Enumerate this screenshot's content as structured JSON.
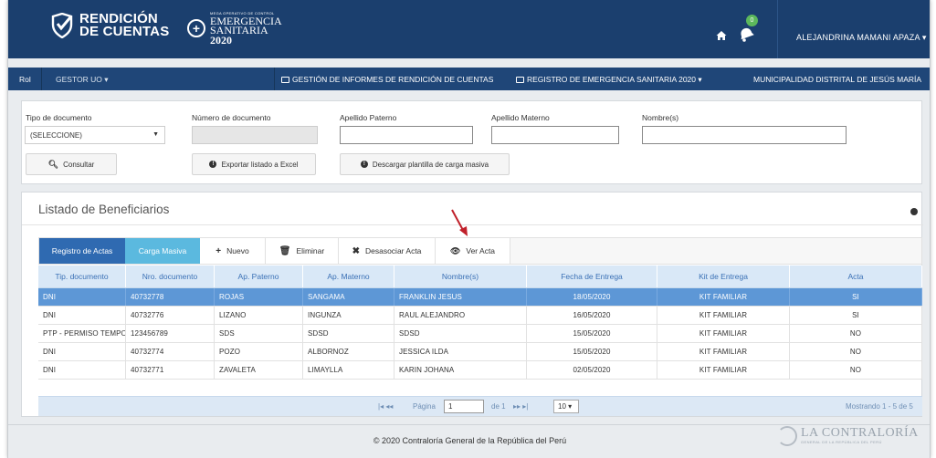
{
  "header": {
    "logo_line1": "RENDICIÓN",
    "logo_line2": "DE CUENTAS",
    "mega_small": "MEGA OPERATIVO DE CONTROL",
    "mega_line1": "EMERGENCIA",
    "mega_line2": "SANITARIA",
    "mega_year": "2020",
    "notif_count": "0",
    "user_name": "ALEJANDRINA MAMANI APAZA ▾",
    "brand_color": "#1b3f6e"
  },
  "nav": {
    "rol": "Rol",
    "gestor": "GESTOR UO ▾",
    "gestion": "GESTIÓN DE INFORMES DE RENDICIÓN DE CUENTAS",
    "registro": "REGISTRO DE EMERGENCIA SANITARIA 2020 ▾",
    "municipalidad": "MUNICIPALIDAD DISTRITAL DE JESÚS MARÍA"
  },
  "filters": {
    "tipo_label": "Tipo de documento",
    "tipo_value": "(SELECCIONE)",
    "numero_label": "Número de documento",
    "numero_value": "",
    "paterno_label": "Apellido Paterno",
    "paterno_value": "",
    "materno_label": "Apellido Materno",
    "materno_value": "",
    "nombre_label": "Nombre(s)",
    "nombre_value": "",
    "consultar": "Consultar",
    "exportar": "Exportar listado a Excel",
    "descargar": "Descargar plantilla de carga masiva"
  },
  "list": {
    "title": "Listado de Beneficiarios",
    "tabs": {
      "registro": "Registro de Actas",
      "carga": "Carga Masiva",
      "nuevo": "Nuevo",
      "eliminar": "Eliminar",
      "desasociar": "Desasociar Acta",
      "ver": "Ver Acta"
    },
    "columns": [
      "Tip. documento",
      "Nro. documento",
      "Ap. Paterno",
      "Ap. Materno",
      "Nombre(s)",
      "Fecha de Entrega",
      "Kit de Entrega",
      "Acta"
    ],
    "rows": [
      [
        "DNI",
        "40732778",
        "ROJAS",
        "SANGAMA",
        "FRANKLIN JESUS",
        "18/05/2020",
        "KIT FAMILIAR",
        "SI"
      ],
      [
        "DNI",
        "40732776",
        "LIZANO",
        "INGUNZA",
        "RAUL ALEJANDRO",
        "16/05/2020",
        "KIT FAMILIAR",
        "SI"
      ],
      [
        "PTP - PERMISO TEMPOR",
        "123456789",
        "SDS",
        "SDSD",
        "SDSD",
        "15/05/2020",
        "KIT FAMILIAR",
        "NO"
      ],
      [
        "DNI",
        "40732774",
        "POZO",
        "ALBORNOZ",
        "JESSICA ILDA",
        "15/05/2020",
        "KIT FAMILIAR",
        "NO"
      ],
      [
        "DNI",
        "40732771",
        "ZAVALETA",
        "LIMAYLLA",
        "KARIN JOHANA",
        "02/05/2020",
        "KIT FAMILIAR",
        "NO"
      ]
    ],
    "pager": {
      "first_prev": "|◂  ◂◂",
      "pagina_label": "Página",
      "page": "1",
      "of": "de 1",
      "next_last": "▸▸  ▸|",
      "page_size": "10 ▾",
      "showing": "Mostrando 1 - 5 de 5"
    }
  },
  "footer": {
    "copyright": "© 2020 Contraloría General de la República del Perú",
    "contraloria_line1": "LA CONTRALORÍA",
    "contraloria_line2": "GENERAL DE LA REPÚBLICA DEL PERÚ"
  }
}
